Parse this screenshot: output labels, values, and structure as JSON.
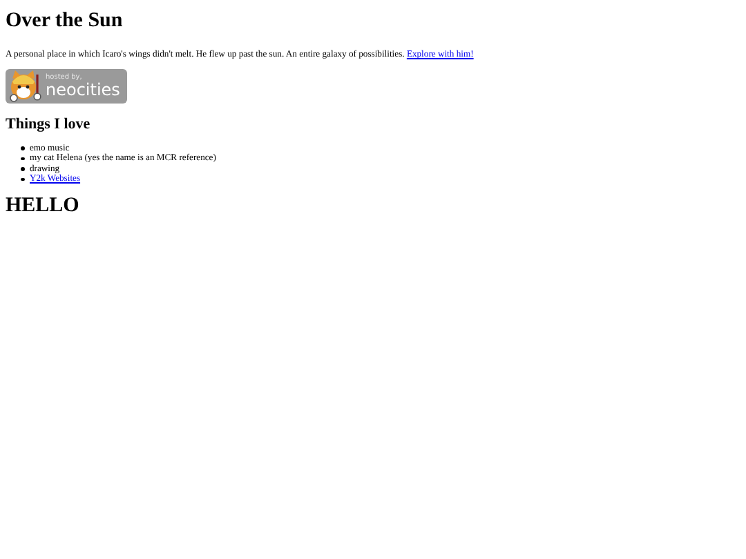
{
  "title": "Over the Sun",
  "intro": {
    "text": "A personal place in which Icaro's wings didn't melt. He flew up past the sun. An entire galaxy of possibilities.",
    "link": "Explore with him!"
  },
  "badge": {
    "line_1": "hosted by,",
    "line_2": "neocities"
  },
  "section_heading": "Things I love",
  "items": [
    {
      "kind": "text",
      "label": "emo music"
    },
    {
      "kind": "text",
      "label": "my cat Helena (yes the name is an MCR reference)"
    },
    {
      "kind": "text",
      "label": "drawing"
    },
    {
      "kind": "link",
      "label": "Y2k Websites"
    }
  ],
  "footer_heading": "HELLO"
}
